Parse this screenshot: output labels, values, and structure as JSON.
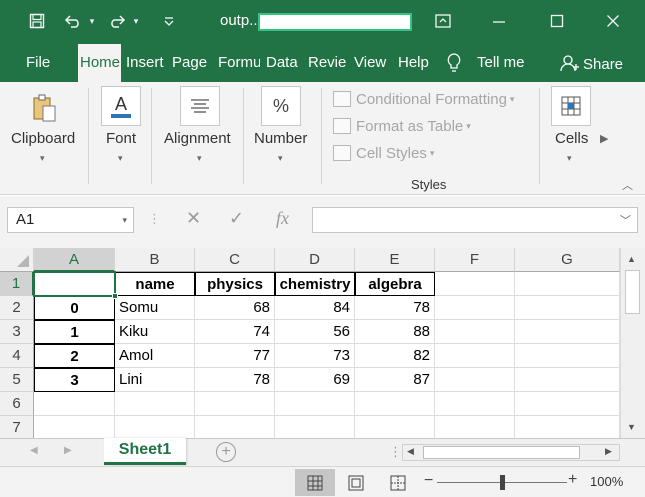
{
  "window": {
    "file_name": "outp...",
    "colors": {
      "accent": "#217346",
      "ribbon_bg": "#f3f3f3",
      "search_border": "#33c481"
    }
  },
  "ribbon": {
    "tabs": [
      {
        "label": "File",
        "active": false
      },
      {
        "label": "Home",
        "active": true
      },
      {
        "label": "Insert",
        "active": false
      },
      {
        "label": "Page L",
        "active": false
      },
      {
        "label": "Formu",
        "active": false
      },
      {
        "label": "Data",
        "active": false
      },
      {
        "label": "Revie",
        "active": false
      },
      {
        "label": "View",
        "active": false
      },
      {
        "label": "Help",
        "active": false
      }
    ],
    "tell_me": "Tell me",
    "share": "Share",
    "groups": {
      "clipboard": "Clipboard",
      "font": "Font",
      "alignment": "Alignment",
      "number": "Number",
      "styles_group": "Styles",
      "cells": "Cells"
    },
    "styles": {
      "conditional_formatting": "Conditional Formatting",
      "format_as_table": "Format as Table",
      "cell_styles": "Cell Styles"
    }
  },
  "formula_bar": {
    "name_box": "A1",
    "fx": "fx",
    "value": ""
  },
  "sheet": {
    "columns": [
      "A",
      "B",
      "C",
      "D",
      "E",
      "F",
      "G"
    ],
    "rows": [
      "1",
      "2",
      "3",
      "4",
      "5",
      "6",
      "7"
    ],
    "headers": [
      "",
      "name",
      "physics",
      "chemistry",
      "algebra"
    ],
    "data": [
      {
        "index": "0",
        "name": "Somu",
        "physics": "68",
        "chemistry": "84",
        "algebra": "78"
      },
      {
        "index": "1",
        "name": "Kiku",
        "physics": "74",
        "chemistry": "56",
        "algebra": "88"
      },
      {
        "index": "2",
        "name": "Amol",
        "physics": "77",
        "chemistry": "73",
        "algebra": "82"
      },
      {
        "index": "3",
        "name": "Lini",
        "physics": "78",
        "chemistry": "69",
        "algebra": "87"
      }
    ],
    "active_cell": "A1"
  },
  "sheet_tabs": [
    {
      "label": "Sheet1",
      "active": true
    }
  ],
  "status": {
    "zoom": "100%",
    "zoom_fraction": 0.5
  }
}
